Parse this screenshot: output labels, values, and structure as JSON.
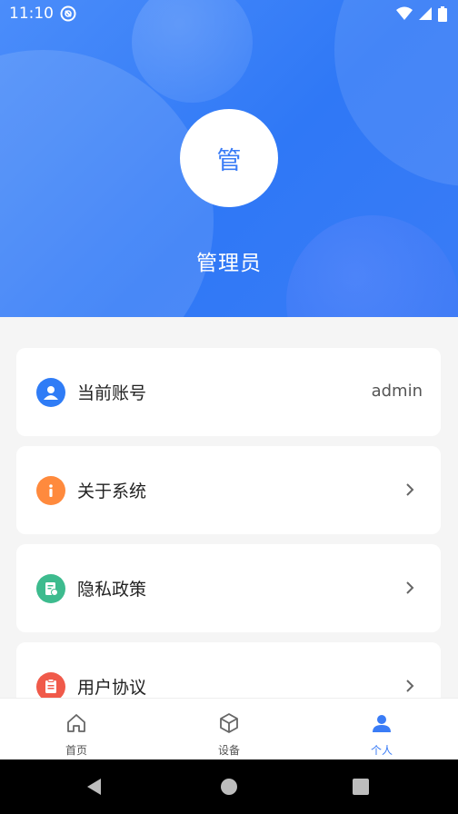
{
  "status_bar": {
    "time": "11:10"
  },
  "profile": {
    "avatar_text": "管",
    "name": "管理员"
  },
  "menu": [
    {
      "label": "当前账号",
      "value": "admin",
      "icon": "user-circle-icon",
      "color": "#2f7cf6"
    },
    {
      "label": "关于系统",
      "icon": "info-icon",
      "color": "#ff8a3d"
    },
    {
      "label": "隐私政策",
      "icon": "privacy-doc-icon",
      "color": "#3dbb8e"
    },
    {
      "label": "用户协议",
      "icon": "agreement-doc-icon",
      "color": "#f05a4a"
    }
  ],
  "bottom_nav": [
    {
      "label": "首页",
      "icon": "home-icon",
      "active": false
    },
    {
      "label": "设备",
      "icon": "cube-icon",
      "active": false
    },
    {
      "label": "个人",
      "icon": "person-icon",
      "active": true
    }
  ],
  "colors": {
    "primary": "#3a7cf6",
    "background": "#f5f5f5"
  }
}
